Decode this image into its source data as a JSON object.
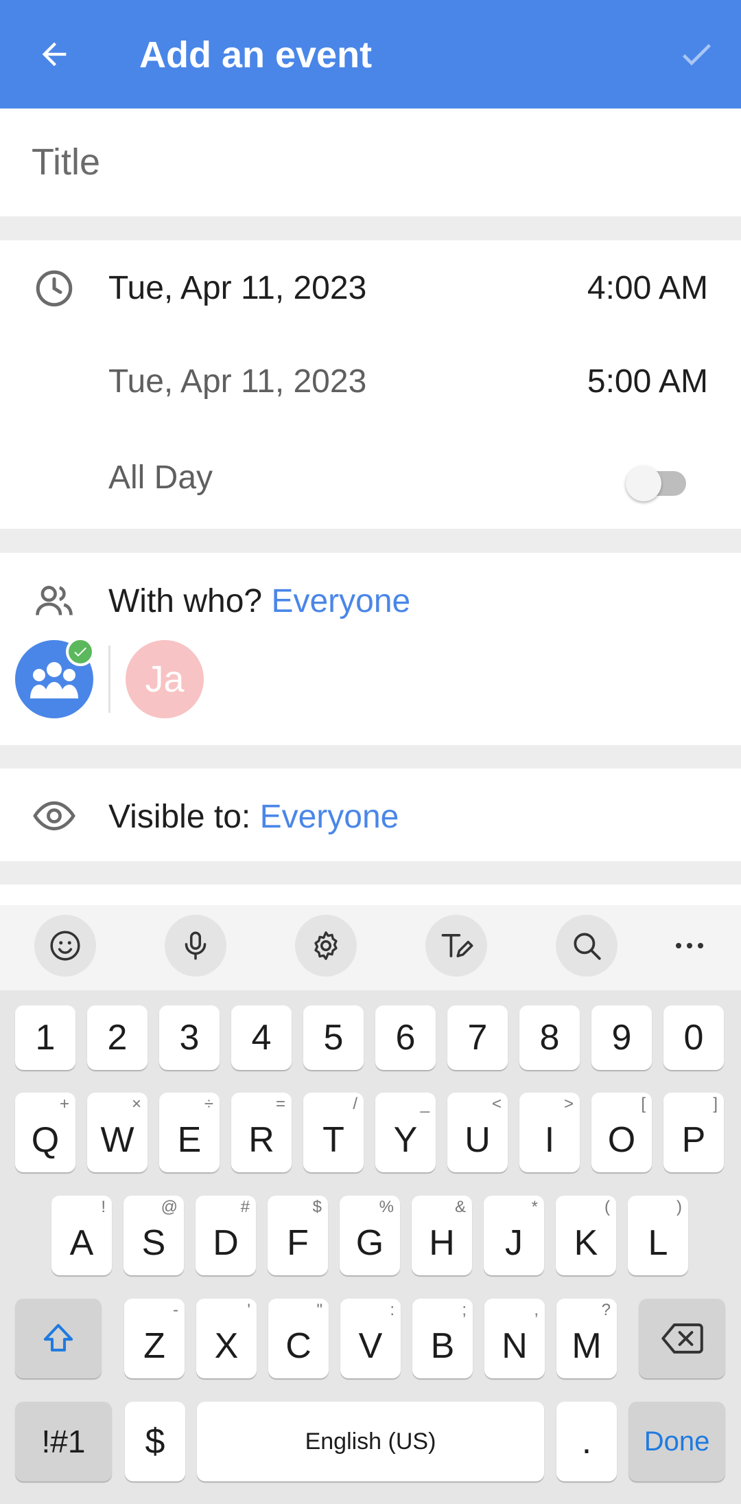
{
  "appbar": {
    "title": "Add an event",
    "back_icon": "arrow-left-icon",
    "save_icon": "check-icon"
  },
  "title_field": {
    "placeholder": "Title"
  },
  "time": {
    "start_date": "Tue, Apr 11, 2023",
    "start_time": "4:00 AM",
    "end_date": "Tue, Apr 11, 2023",
    "end_time": "5:00 AM",
    "all_day_label": "All Day",
    "all_day_on": false
  },
  "participants": {
    "label": "With who?",
    "value": "Everyone",
    "member_initials": "Ja"
  },
  "visibility": {
    "label": "Visible to:",
    "value": "Everyone"
  },
  "keyboard": {
    "number_row": [
      "1",
      "2",
      "3",
      "4",
      "5",
      "6",
      "7",
      "8",
      "9",
      "0"
    ],
    "row1": [
      {
        "k": "Q",
        "h": "+"
      },
      {
        "k": "W",
        "h": "×"
      },
      {
        "k": "E",
        "h": "÷"
      },
      {
        "k": "R",
        "h": "="
      },
      {
        "k": "T",
        "h": "/"
      },
      {
        "k": "Y",
        "h": "_"
      },
      {
        "k": "U",
        "h": "<"
      },
      {
        "k": "I",
        "h": ">"
      },
      {
        "k": "O",
        "h": "["
      },
      {
        "k": "P",
        "h": "]"
      }
    ],
    "row2": [
      {
        "k": "A",
        "h": "!"
      },
      {
        "k": "S",
        "h": "@"
      },
      {
        "k": "D",
        "h": "#"
      },
      {
        "k": "F",
        "h": "$"
      },
      {
        "k": "G",
        "h": "%"
      },
      {
        "k": "H",
        "h": "&"
      },
      {
        "k": "J",
        "h": "*"
      },
      {
        "k": "K",
        "h": "("
      },
      {
        "k": "L",
        "h": ")"
      }
    ],
    "row3": [
      {
        "k": "Z",
        "h": "-"
      },
      {
        "k": "X",
        "h": "'"
      },
      {
        "k": "C",
        "h": "\""
      },
      {
        "k": "V",
        "h": ":"
      },
      {
        "k": "B",
        "h": ";"
      },
      {
        "k": "N",
        "h": ","
      },
      {
        "k": "M",
        "h": "?"
      }
    ],
    "symbols_key": "!#1",
    "currency_key": "$",
    "space_label": "English (US)",
    "period_key": ".",
    "done_key": "Done"
  },
  "colors": {
    "accent": "#4a86e8",
    "success": "#5cb85c",
    "avatar_pink": "#f8c3c4"
  }
}
